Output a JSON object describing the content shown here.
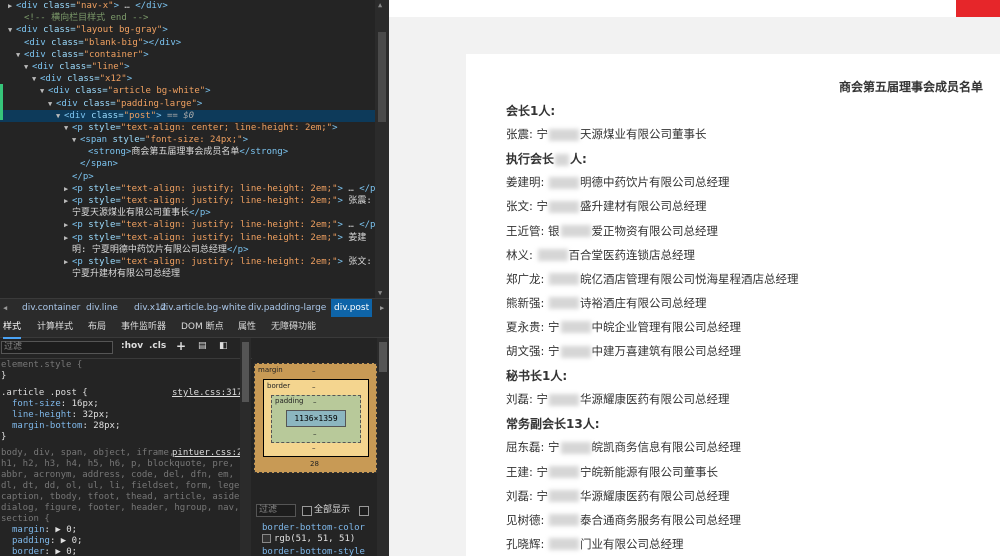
{
  "devtools": {
    "dom_lines": [
      {
        "indent": 2,
        "tri": "▶",
        "html": "<span class='tag'>&lt;div</span> <span class='attr'>class=</span><span class='val'>\"nav-x\"</span><span class='tag'>&gt;</span> … <span class='tag'>&lt;/div&gt;</span>"
      },
      {
        "indent": 3,
        "tri": "",
        "html": "<span class='cmt'>&lt;!-- 横向栏目样式 end --&gt;</span>"
      },
      {
        "indent": 2,
        "tri": "▼",
        "html": "<span class='tag'>&lt;div</span> <span class='attr'>class=</span><span class='val'>\"layout bg-gray\"</span><span class='tag'>&gt;</span>"
      },
      {
        "indent": 3,
        "tri": "",
        "html": "<span class='tag'>&lt;div</span> <span class='attr'>class=</span><span class='val'>\"blank-big\"</span><span class='tag'>&gt;&lt;/div&gt;</span>"
      },
      {
        "indent": 3,
        "tri": "▼",
        "html": "<span class='tag'>&lt;div</span> <span class='attr'>class=</span><span class='val'>\"container\"</span><span class='tag'>&gt;</span>"
      },
      {
        "indent": 4,
        "tri": "▼",
        "html": "<span class='tag'>&lt;div</span> <span class='attr'>class=</span><span class='val'>\"line\"</span><span class='tag'>&gt;</span>"
      },
      {
        "indent": 5,
        "tri": "▼",
        "html": "<span class='tag'>&lt;div</span> <span class='attr'>class=</span><span class='val'>\"x12\"</span><span class='tag'>&gt;</span>"
      },
      {
        "indent": 6,
        "tri": "▼",
        "html": "<span class='tag'>&lt;div</span> <span class='attr'>class=</span><span class='val'>\"article bg-white\"</span><span class='tag'>&gt;</span>"
      },
      {
        "indent": 7,
        "tri": "▼",
        "html": "<span class='tag'>&lt;div</span> <span class='attr'>class=</span><span class='val'>\"padding-large\"</span><span class='tag'>&gt;</span>"
      },
      {
        "indent": 8,
        "tri": "▼",
        "html": "<span class='tag'>&lt;div</span> <span class='attr'>class=</span><span class='val'>\"post\"</span><span class='tag'>&gt;</span> <span class='eq0'>== $0</span>",
        "sel": true
      },
      {
        "indent": 9,
        "tri": "▼",
        "html": "<span class='tag'>&lt;p</span> <span class='attr'>style=</span><span class='val'>\"text-align: center; line-height: 2em;\"</span><span class='tag'>&gt;</span>"
      },
      {
        "indent": 10,
        "tri": "▼",
        "html": "<span class='tag'>&lt;span</span> <span class='attr'>style=</span><span class='val'>\"font-size: 24px;\"</span><span class='tag'>&gt;</span>"
      },
      {
        "indent": 11,
        "tri": "",
        "html": "<span class='tag'>&lt;strong&gt;</span><span class='txt'>商会第五届理事会成员名单</span><span class='tag'>&lt;/strong&gt;</span>"
      },
      {
        "indent": 10,
        "tri": "",
        "html": "<span class='tag'>&lt;/span&gt;</span>"
      },
      {
        "indent": 9,
        "tri": "",
        "html": "<span class='tag'>&lt;/p&gt;</span>"
      },
      {
        "indent": 9,
        "tri": "▶",
        "html": "<span class='tag'>&lt;p</span> <span class='attr'>style=</span><span class='val'>\"text-align: justify; line-height: 2em;\"</span><span class='tag'>&gt;</span> … <span class='tag'>&lt;/p&gt;</span>"
      },
      {
        "indent": 9,
        "tri": "▶",
        "html": "<span class='tag'>&lt;p</span> <span class='attr'>style=</span><span class='val'>\"text-align: justify; line-height: 2em;\"</span><span class='tag'>&gt;</span> <span class='txt'>张震:</span>"
      },
      {
        "indent": 9,
        "tri": "",
        "html": "<span class='txt'>宁夏天源煤业有限公司董事长</span><span class='tag'>&lt;/p&gt;</span>"
      },
      {
        "indent": 9,
        "tri": "▶",
        "html": "<span class='tag'>&lt;p</span> <span class='attr'>style=</span><span class='val'>\"text-align: justify; line-height: 2em;\"</span><span class='tag'>&gt;</span> … <span class='tag'>&lt;/p&gt;</span>"
      },
      {
        "indent": 9,
        "tri": "▶",
        "html": "<span class='tag'>&lt;p</span> <span class='attr'>style=</span><span class='val'>\"text-align: justify; line-height: 2em;\"</span><span class='tag'>&gt;</span> <span class='txt'>姜建</span>"
      },
      {
        "indent": 9,
        "tri": "",
        "html": "<span class='txt'>明: 宁夏明德中药饮片有限公司总经理</span><span class='tag'>&lt;/p&gt;</span>"
      },
      {
        "indent": 9,
        "tri": "▶",
        "html": "<span class='tag'>&lt;p</span> <span class='attr'>style=</span><span class='val'>\"text-align: justify; line-height: 2em;\"</span><span class='tag'>&gt;</span> <span class='txt'>张文:</span>"
      },
      {
        "indent": 9,
        "tri": "",
        "html": "<span class='txt'>宁夏升建材有限公司总经理</span>"
      }
    ],
    "breadcrumbs": [
      "div.container",
      "div.line",
      "div.x12",
      "div.article.bg-white",
      "div.padding-large",
      "div.post"
    ],
    "tabs": [
      "样式",
      "计算样式",
      "布局",
      "事件监听器",
      "DOM 断点",
      "属性",
      "无障碍功能"
    ],
    "filter_placeholder": "过滤",
    "hov_label": ":hov",
    "cls_label": ".cls",
    "styles": {
      "element_style": "element.style {",
      "close1": "}",
      "rule_selector": ".article .post {",
      "rule_source": "style.css:317",
      "rule_props": [
        {
          "p": "font-size",
          "v": "16px;"
        },
        {
          "p": "line-height",
          "v": "32px;"
        },
        {
          "p": "margin-bottom",
          "v": "28px;"
        }
      ],
      "close2": "}",
      "reset_source": "pintuer.css:2",
      "reset_selectors": [
        "body, div, span, object, iframe,",
        "h1, h2, h3, h4, h5, h6, p, blockquote, pre, a,",
        "abbr, acronym, address, code, del, dfn, em, q,",
        "dl, dt, dd, ol, ul, li, fieldset, form, legend,",
        "caption, tbody, tfoot, thead, article, aside,",
        "dialog, figure, footer, header, hgroup, nav,",
        "section {"
      ],
      "reset_props": [
        {
          "p": "margin",
          "v": "▶ 0;"
        },
        {
          "p": "padding",
          "v": "▶ 0;"
        },
        {
          "p": "border",
          "v": "▶ 0;"
        }
      ]
    },
    "boxmodel": {
      "margin_label": "margin",
      "border_label": "border",
      "padding_label": "padding",
      "content": "1136×1359",
      "dash": "–",
      "margin_bottom": "28"
    },
    "computed": {
      "filter_placeholder": "过滤",
      "show_all": "全部显示",
      "props": [
        {
          "p": "border-bottom-color",
          "v": "rgb(51, 51, 51)"
        },
        {
          "p": "border-bottom-style",
          "v": ""
        }
      ]
    }
  },
  "page": {
    "title": "商会第五届理事会成员名单",
    "lines": [
      {
        "type": "head",
        "text": "会长1人:"
      },
      {
        "type": "item",
        "name": "张震:",
        "pre": "宁",
        "post": "天源煤业有限公司董事长"
      },
      {
        "type": "head",
        "text": "执行会长",
        "tail": "人:"
      },
      {
        "type": "item",
        "name": "姜建明:",
        "pre": "",
        "post": "明德中药饮片有限公司总经理"
      },
      {
        "type": "item",
        "name": "张文:",
        "pre": "宁",
        "post": "盛升建材有限公司总经理"
      },
      {
        "type": "item",
        "name": "王近管:",
        "pre": "银",
        "post": "爱正物资有限公司总经理"
      },
      {
        "type": "item",
        "name": "林义:",
        "pre": "",
        "post": "百合堂医药连锁店总经理"
      },
      {
        "type": "item",
        "name": "郑广龙:",
        "pre": "",
        "post": "皖亿酒店管理有限公司悦海星程酒店总经理"
      },
      {
        "type": "item",
        "name": "熊新强:",
        "pre": "",
        "post": "诗裕酒庄有限公司总经理"
      },
      {
        "type": "item",
        "name": "夏永贵:",
        "pre": "宁",
        "post": "中皖企业管理有限公司总经理"
      },
      {
        "type": "item",
        "name": "胡文强:",
        "pre": "宁",
        "post": "中建万喜建筑有限公司总经理"
      },
      {
        "type": "head",
        "text": "秘书长1人:"
      },
      {
        "type": "item",
        "name": "刘磊:",
        "pre": "宁",
        "post": "华源耀康医药有限公司总经理"
      },
      {
        "type": "head",
        "text": "常务副会长13人:"
      },
      {
        "type": "item",
        "name": "屈东磊:",
        "pre": "宁",
        "post": "皖凯商务信息有限公司总经理"
      },
      {
        "type": "item",
        "name": "王建:",
        "pre": "宁",
        "post": "宁皖新能源有限公司董事长"
      },
      {
        "type": "item",
        "name": "刘磊:",
        "pre": "宁",
        "post": "华源耀康医药有限公司总经理"
      },
      {
        "type": "item",
        "name": "见树德:",
        "pre": "",
        "post": "泰合通商务服务有限公司总经理"
      },
      {
        "type": "item",
        "name": "孔晓辉:",
        "pre": "",
        "post": "门业有限公司总经理"
      }
    ]
  },
  "colors": {
    "accent_red": "#e6262a",
    "selection": "#0d3a5a",
    "tab_active": "#4aa3f5"
  }
}
